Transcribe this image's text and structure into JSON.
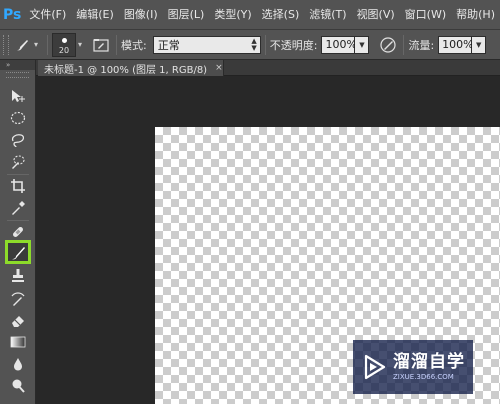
{
  "app": {
    "logo": "Ps"
  },
  "menu": {
    "items": [
      {
        "label": "文件(F)"
      },
      {
        "label": "编辑(E)"
      },
      {
        "label": "图像(I)"
      },
      {
        "label": "图层(L)"
      },
      {
        "label": "类型(Y)"
      },
      {
        "label": "选择(S)"
      },
      {
        "label": "滤镜(T)"
      },
      {
        "label": "视图(V)"
      },
      {
        "label": "窗口(W)"
      },
      {
        "label": "帮助(H)"
      }
    ]
  },
  "options": {
    "brush_size": "20",
    "mode_label": "模式:",
    "mode_value": "正常",
    "opacity_label": "不透明度:",
    "opacity_value": "100%",
    "flow_label": "流量:",
    "flow_value": "100%"
  },
  "document": {
    "tab_title": "未标题-1 @ 100% (图层 1, RGB/8)",
    "close_glyph": "×"
  },
  "toolbox": {
    "collapse_glyph": "»",
    "active_tool": "brush-tool",
    "accent_color": "#8ddb2a"
  },
  "watermark": {
    "title": "溜溜自学",
    "url": "ZIXUE.3D66.COM"
  }
}
